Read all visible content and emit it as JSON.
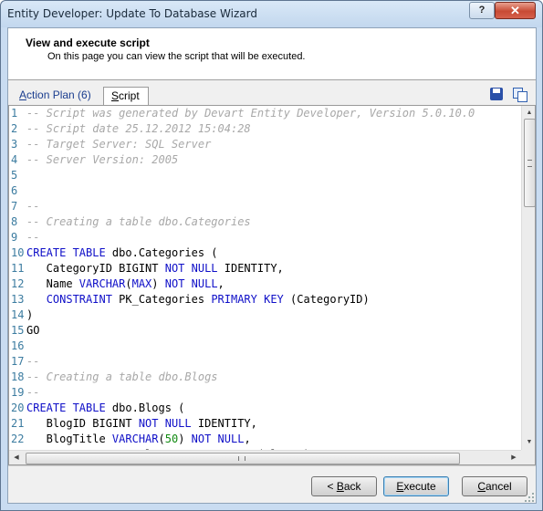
{
  "window": {
    "title": "Entity Developer: Update To Database Wizard",
    "help_label": "?",
    "close_label": "✕"
  },
  "header": {
    "title": "View and execute script",
    "subtitle": "On this page you can view the script that will be executed."
  },
  "tabs": [
    {
      "label_mnemonic": "A",
      "label_rest": "ction Plan (6)",
      "active": false
    },
    {
      "label_mnemonic": "S",
      "label_rest": "cript",
      "active": true
    }
  ],
  "toolbar": {
    "save_icon": "save-icon",
    "copy_icon": "copy-icon"
  },
  "script": {
    "lines": [
      {
        "n": "1",
        "tokens": [
          {
            "t": "-- Script was generated by Devart Entity Developer, Version 5.0.10.0",
            "c": "cm"
          }
        ]
      },
      {
        "n": "2",
        "tokens": [
          {
            "t": "-- Script date 25.12.2012 15:04:28",
            "c": "cm"
          }
        ]
      },
      {
        "n": "3",
        "tokens": [
          {
            "t": "-- Target Server: SQL Server",
            "c": "cm"
          }
        ]
      },
      {
        "n": "4",
        "tokens": [
          {
            "t": "-- Server Version: 2005",
            "c": "cm"
          }
        ]
      },
      {
        "n": "5",
        "tokens": []
      },
      {
        "n": "6",
        "tokens": []
      },
      {
        "n": "7",
        "tokens": [
          {
            "t": "--",
            "c": "cm"
          }
        ]
      },
      {
        "n": "8",
        "tokens": [
          {
            "t": "-- Creating a table dbo.Categories",
            "c": "cm"
          }
        ]
      },
      {
        "n": "9",
        "tokens": [
          {
            "t": "--",
            "c": "cm"
          }
        ]
      },
      {
        "n": "10",
        "tokens": [
          {
            "t": "CREATE TABLE",
            "c": "kw"
          },
          {
            "t": " dbo.Categories (",
            "c": "txt"
          }
        ]
      },
      {
        "n": "11",
        "tokens": [
          {
            "t": "   CategoryID BIGINT ",
            "c": "txt"
          },
          {
            "t": "NOT NULL",
            "c": "kw"
          },
          {
            "t": " IDENTITY,",
            "c": "txt"
          }
        ]
      },
      {
        "n": "12",
        "tokens": [
          {
            "t": "   Name ",
            "c": "txt"
          },
          {
            "t": "VARCHAR",
            "c": "kw"
          },
          {
            "t": "(",
            "c": "txt"
          },
          {
            "t": "MAX",
            "c": "kw"
          },
          {
            "t": ") ",
            "c": "txt"
          },
          {
            "t": "NOT NULL",
            "c": "kw"
          },
          {
            "t": ",",
            "c": "txt"
          }
        ]
      },
      {
        "n": "13",
        "tokens": [
          {
            "t": "   ",
            "c": "txt"
          },
          {
            "t": "CONSTRAINT",
            "c": "kw"
          },
          {
            "t": " PK_Categories ",
            "c": "txt"
          },
          {
            "t": "PRIMARY KEY",
            "c": "kw"
          },
          {
            "t": " (CategoryID)",
            "c": "txt"
          }
        ]
      },
      {
        "n": "14",
        "tokens": [
          {
            "t": ")",
            "c": "txt"
          }
        ]
      },
      {
        "n": "15",
        "tokens": [
          {
            "t": "GO",
            "c": "txt"
          }
        ]
      },
      {
        "n": "16",
        "tokens": []
      },
      {
        "n": "17",
        "tokens": [
          {
            "t": "--",
            "c": "cm"
          }
        ]
      },
      {
        "n": "18",
        "tokens": [
          {
            "t": "-- Creating a table dbo.Blogs",
            "c": "cm"
          }
        ]
      },
      {
        "n": "19",
        "tokens": [
          {
            "t": "--",
            "c": "cm"
          }
        ]
      },
      {
        "n": "20",
        "tokens": [
          {
            "t": "CREATE TABLE",
            "c": "kw"
          },
          {
            "t": " dbo.Blogs (",
            "c": "txt"
          }
        ]
      },
      {
        "n": "21",
        "tokens": [
          {
            "t": "   BlogID BIGINT ",
            "c": "txt"
          },
          {
            "t": "NOT NULL",
            "c": "kw"
          },
          {
            "t": " IDENTITY,",
            "c": "txt"
          }
        ]
      },
      {
        "n": "22",
        "tokens": [
          {
            "t": "   BlogTitle ",
            "c": "txt"
          },
          {
            "t": "VARCHAR",
            "c": "kw"
          },
          {
            "t": "(",
            "c": "txt"
          },
          {
            "t": "50",
            "c": "nm"
          },
          {
            "t": ") ",
            "c": "txt"
          },
          {
            "t": "NOT NULL",
            "c": "kw"
          },
          {
            "t": ",",
            "c": "txt"
          }
        ]
      },
      {
        "n": "23",
        "tokens": [
          {
            "t": "   ",
            "c": "txt"
          },
          {
            "t": "CONSTRAINT",
            "c": "kw"
          },
          {
            "t": " PK_Blogs ",
            "c": "txt"
          },
          {
            "t": "PRIMARY KEY",
            "c": "kw"
          },
          {
            "t": " (BlogID)",
            "c": "txt"
          }
        ]
      }
    ]
  },
  "buttons": {
    "back": {
      "prefix": "< ",
      "mnemonic": "B",
      "rest": "ack"
    },
    "execute": {
      "prefix": "",
      "mnemonic": "E",
      "rest": "xecute"
    },
    "cancel": {
      "prefix": "",
      "mnemonic": "C",
      "rest": "ancel"
    }
  },
  "colors": {
    "keyword": "#1010c8",
    "comment": "#a8a8a8",
    "number": "#118a11",
    "line_number": "#3c7ca0"
  }
}
